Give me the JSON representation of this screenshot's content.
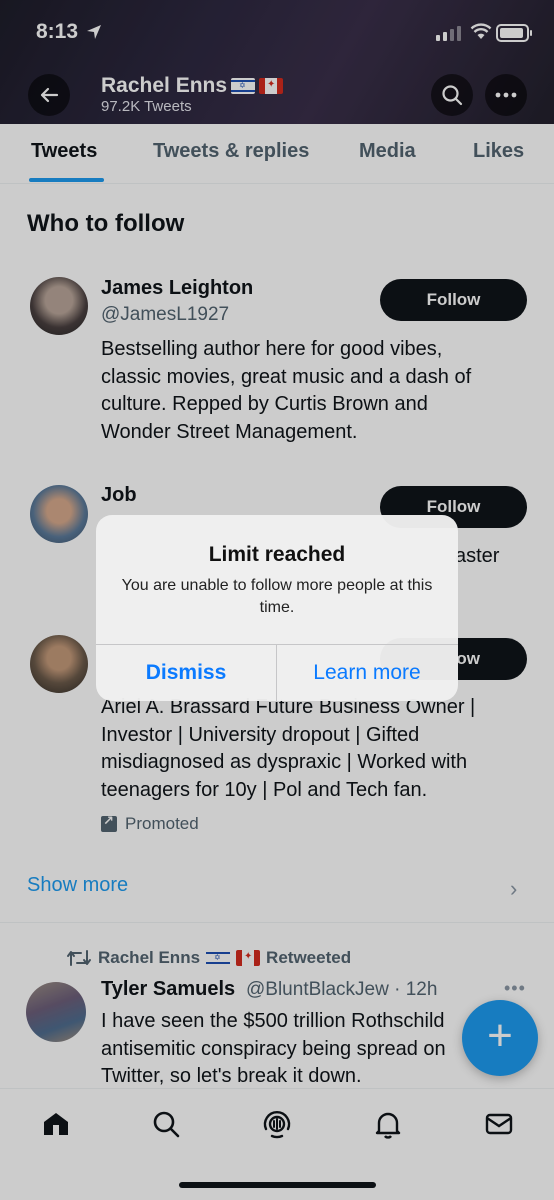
{
  "status_bar": {
    "time": "8:13"
  },
  "header": {
    "name": "Rachel Enns",
    "tweet_count": "97.2K Tweets"
  },
  "tabs": [
    {
      "label": "Tweets",
      "active": true
    },
    {
      "label": "Tweets & replies",
      "active": false
    },
    {
      "label": "Media",
      "active": false
    },
    {
      "label": "Likes",
      "active": false
    }
  ],
  "who_to_follow": {
    "title": "Who to follow",
    "follow_label": "Follow",
    "suggestions": [
      {
        "name": "James Leighton",
        "handle": "@JamesL1927",
        "bio_lines": [
          "Bestselling author here for good vibes,",
          "classic movies, great music and a dash of",
          "culture. Repped by Curtis Brown and",
          "Wonder Street Management."
        ]
      },
      {
        "name": "Job",
        "bio_fragment": "aster"
      },
      {
        "bio_lines": [
          "Ariel A. Brassard Future Business Owner |",
          "Investor | University dropout | Gifted",
          "misdiagnosed as dyspraxic | Worked with",
          "teenagers for 10y | Pol and Tech fan."
        ],
        "button_fragment": "ow",
        "promoted_label": "Promoted"
      }
    ],
    "show_more": "Show more"
  },
  "tweet": {
    "retweeted_by": "Rachel Enns",
    "retweeted_label": "Retweeted",
    "author_name": "Tyler Samuels",
    "author_meta": "@BluntBlackJew · 12h",
    "text_lines": [
      "I have seen the $500 trillion Rothschild",
      "antisemitic conspiracy being spread on",
      "Twitter, so let's break it down."
    ]
  },
  "alert": {
    "title": "Limit reached",
    "message": "You are unable to follow more people at this time.",
    "dismiss": "Dismiss",
    "learn_more": "Learn more"
  },
  "colors": {
    "accent": "#1d9bf0",
    "alert_button": "#0a7aff",
    "text_primary": "#0f1419",
    "text_secondary": "#536471"
  }
}
